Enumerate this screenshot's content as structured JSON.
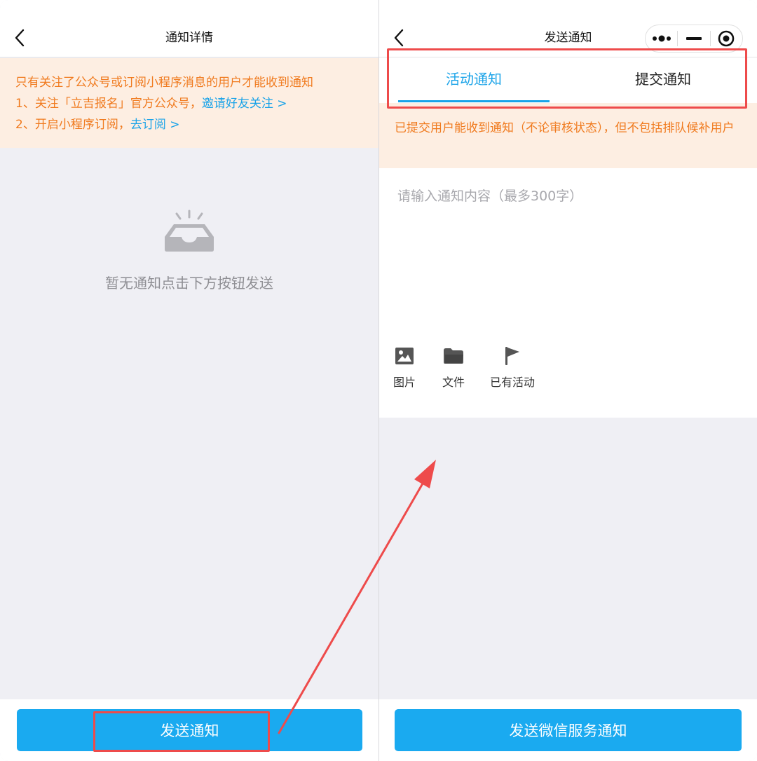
{
  "left": {
    "nav_title": "通知详情",
    "notice": {
      "line1": "只有关注了公众号或订阅小程序消息的用户才能收到通知",
      "line2_text": "1、关注「立吉报名」官方公众号，",
      "line2_link": "邀请好友关注 >",
      "line3_text": "2、开启小程序订阅，",
      "line3_link": "去订阅 >"
    },
    "empty_text": "暂无通知点击下方按钮发送",
    "send_button": "发送通知"
  },
  "right": {
    "nav_title": "发送通知",
    "capsule": {
      "menu_icon": "more-dots-icon",
      "minimize_icon": "minimize-icon",
      "close_icon": "target-close-icon"
    },
    "tabs": [
      {
        "label": "活动通知",
        "active": true
      },
      {
        "label": "提交通知",
        "active": false
      }
    ],
    "notice": "已提交用户能收到通知（不论审核状态），但不包括排队候补用户",
    "editor_placeholder": "请输入通知内容（最多300字）",
    "tools": [
      {
        "label": "图片",
        "icon": "image-icon"
      },
      {
        "label": "文件",
        "icon": "folder-icon"
      },
      {
        "label": "已有活动",
        "icon": "flag-icon"
      }
    ],
    "send_button": "发送微信服务通知"
  },
  "colors": {
    "accent_blue": "#1aa3e8",
    "button_blue": "#1aaaf0",
    "notice_bg": "#fdeee2",
    "notice_text": "#f07a1e",
    "highlight_red": "#ee4b4b"
  }
}
